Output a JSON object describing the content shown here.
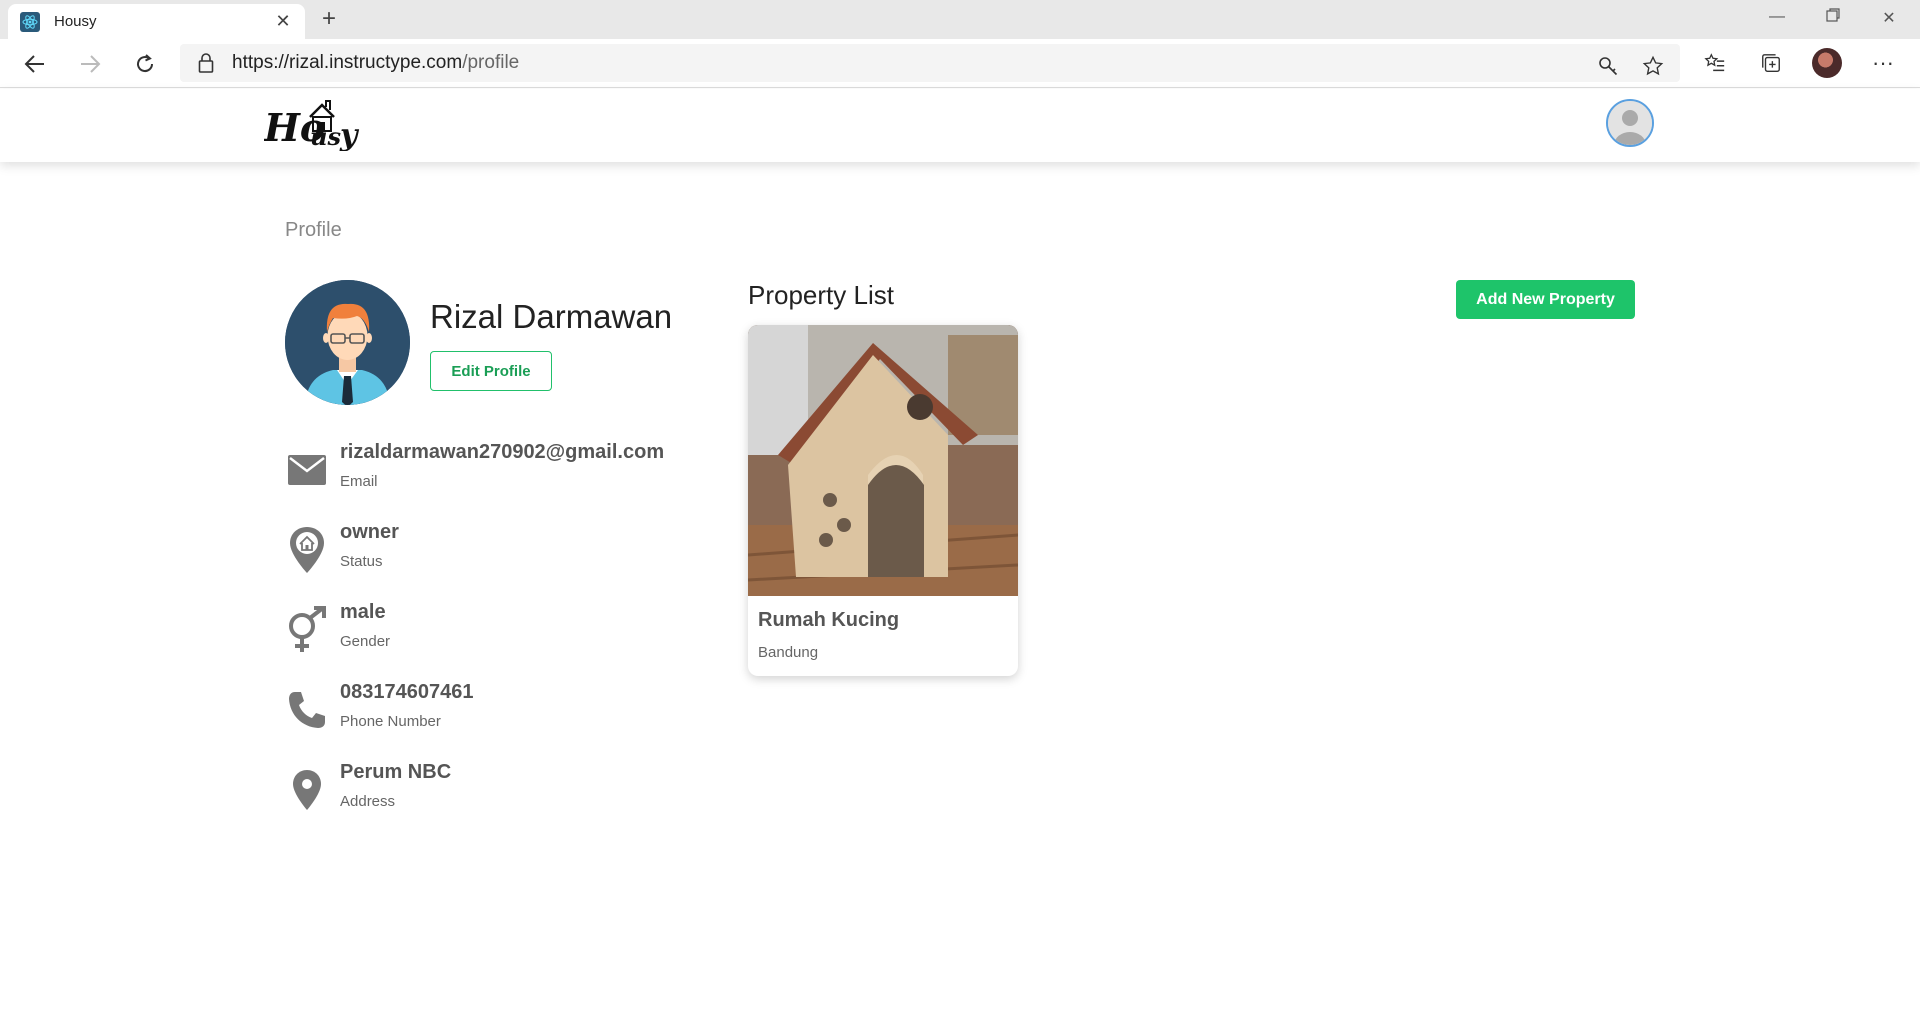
{
  "browser": {
    "tab_title": "Housy",
    "tab_favicon": "react-icon",
    "url_host": "https://rizal.instructype.com",
    "url_path": "/profile"
  },
  "header": {
    "logo_text": "Housy"
  },
  "breadcrumb": "Profile",
  "profile": {
    "name": "Rizal Darmawan",
    "edit_label": "Edit Profile",
    "info": [
      {
        "icon": "mail-icon",
        "value": "rizaldarmawan270902@gmail.com",
        "label": "Email"
      },
      {
        "icon": "home-pin-icon",
        "value": "owner",
        "label": "Status"
      },
      {
        "icon": "gender-icon",
        "value": "male",
        "label": "Gender"
      },
      {
        "icon": "phone-icon",
        "value": "083174607461",
        "label": "Phone Number"
      },
      {
        "icon": "location-pin-icon",
        "value": "Perum NBC",
        "label": "Address"
      }
    ]
  },
  "properties": {
    "title": "Property List",
    "add_label": "Add New Property",
    "items": [
      {
        "name": "Rumah Kucing",
        "city": "Bandung"
      }
    ]
  },
  "colors": {
    "accent_green": "#1ec46a",
    "avatar_bg": "#2d4f6c"
  }
}
